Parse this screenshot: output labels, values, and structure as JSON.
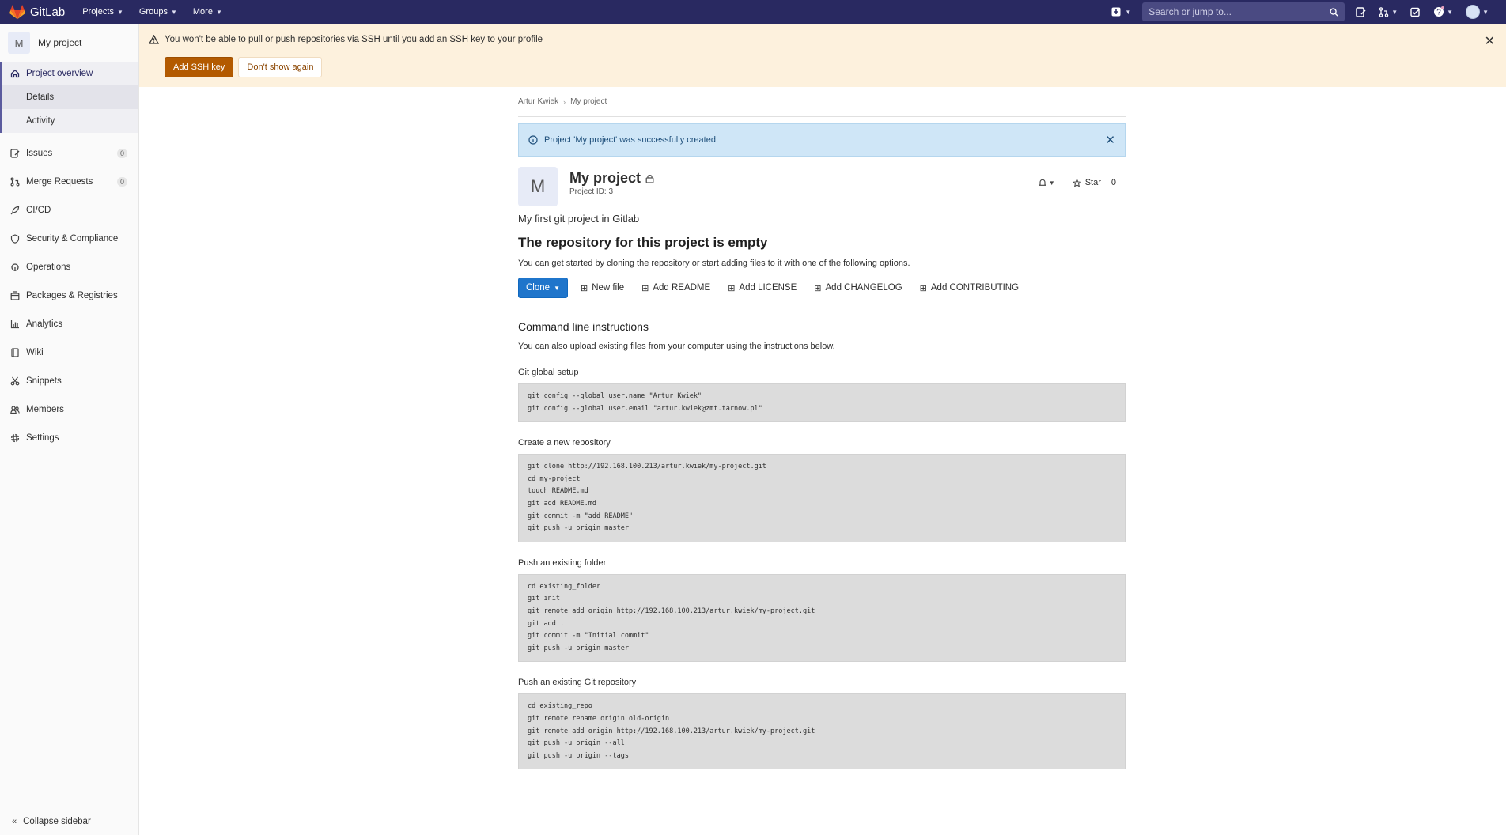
{
  "navbar": {
    "brand": "GitLab",
    "menu": [
      "Projects",
      "Groups",
      "More"
    ],
    "search_placeholder": "Search or jump to...",
    "bg_color": "#292961"
  },
  "sidebar": {
    "project_avatar": "M",
    "project_name": "My project",
    "overview": "Project overview",
    "overview_sub": [
      "Details",
      "Activity"
    ],
    "items": [
      {
        "label": "Issues",
        "count": "0",
        "icon": "issues-icon"
      },
      {
        "label": "Merge Requests",
        "count": "0",
        "icon": "merge-request-icon"
      },
      {
        "label": "CI/CD",
        "icon": "rocket-icon"
      },
      {
        "label": "Security & Compliance",
        "icon": "shield-icon"
      },
      {
        "label": "Operations",
        "icon": "cloud-icon"
      },
      {
        "label": "Packages & Registries",
        "icon": "package-icon"
      },
      {
        "label": "Analytics",
        "icon": "chart-icon"
      },
      {
        "label": "Wiki",
        "icon": "book-icon"
      },
      {
        "label": "Snippets",
        "icon": "scissors-icon"
      },
      {
        "label": "Members",
        "icon": "users-icon"
      },
      {
        "label": "Settings",
        "icon": "gear-icon"
      }
    ],
    "collapse": "Collapse sidebar"
  },
  "ssh_banner": {
    "message": "You won't be able to pull or push repositories via SSH until you add an SSH key to your profile",
    "add_button": "Add SSH key",
    "dismiss_button": "Don't show again",
    "bg_color": "#fdf1dd"
  },
  "breadcrumb": [
    "Artur Kwiek",
    "My project"
  ],
  "flash": {
    "message": "Project 'My project' was successfully created."
  },
  "project": {
    "avatar": "M",
    "name": "My project",
    "id_text": "Project ID: 3",
    "description": "My first git project in Gitlab",
    "star_label": "Star",
    "star_count": "0"
  },
  "empty": {
    "title": "The repository for this project is empty",
    "subtitle": "You can get started by cloning the repository or start adding files to it with one of the following options.",
    "clone": "Clone",
    "actions": [
      "New file",
      "Add README",
      "Add LICENSE",
      "Add CHANGELOG",
      "Add CONTRIBUTING"
    ]
  },
  "cli": {
    "title": "Command line instructions",
    "subtitle": "You can also upload existing files from your computer using the instructions below.",
    "sections": [
      {
        "label": "Git global setup",
        "lines": [
          "git config --global user.name \"Artur Kwiek\"",
          "git config --global user.email \"artur.kwiek@zmt.tarnow.pl\""
        ]
      },
      {
        "label": "Create a new repository",
        "lines": [
          "git clone http://192.168.100.213/artur.kwiek/my-project.git",
          "cd my-project",
          "touch README.md",
          "git add README.md",
          "git commit -m \"add README\"",
          "git push -u origin master"
        ]
      },
      {
        "label": "Push an existing folder",
        "lines": [
          "cd existing_folder",
          "git init",
          "git remote add origin http://192.168.100.213/artur.kwiek/my-project.git",
          "git add .",
          "git commit -m \"Initial commit\"",
          "git push -u origin master"
        ]
      },
      {
        "label": "Push an existing Git repository",
        "lines": [
          "cd existing_repo",
          "git remote rename origin old-origin",
          "git remote add origin http://192.168.100.213/artur.kwiek/my-project.git",
          "git push -u origin --all",
          "git push -u origin --tags"
        ]
      }
    ]
  }
}
